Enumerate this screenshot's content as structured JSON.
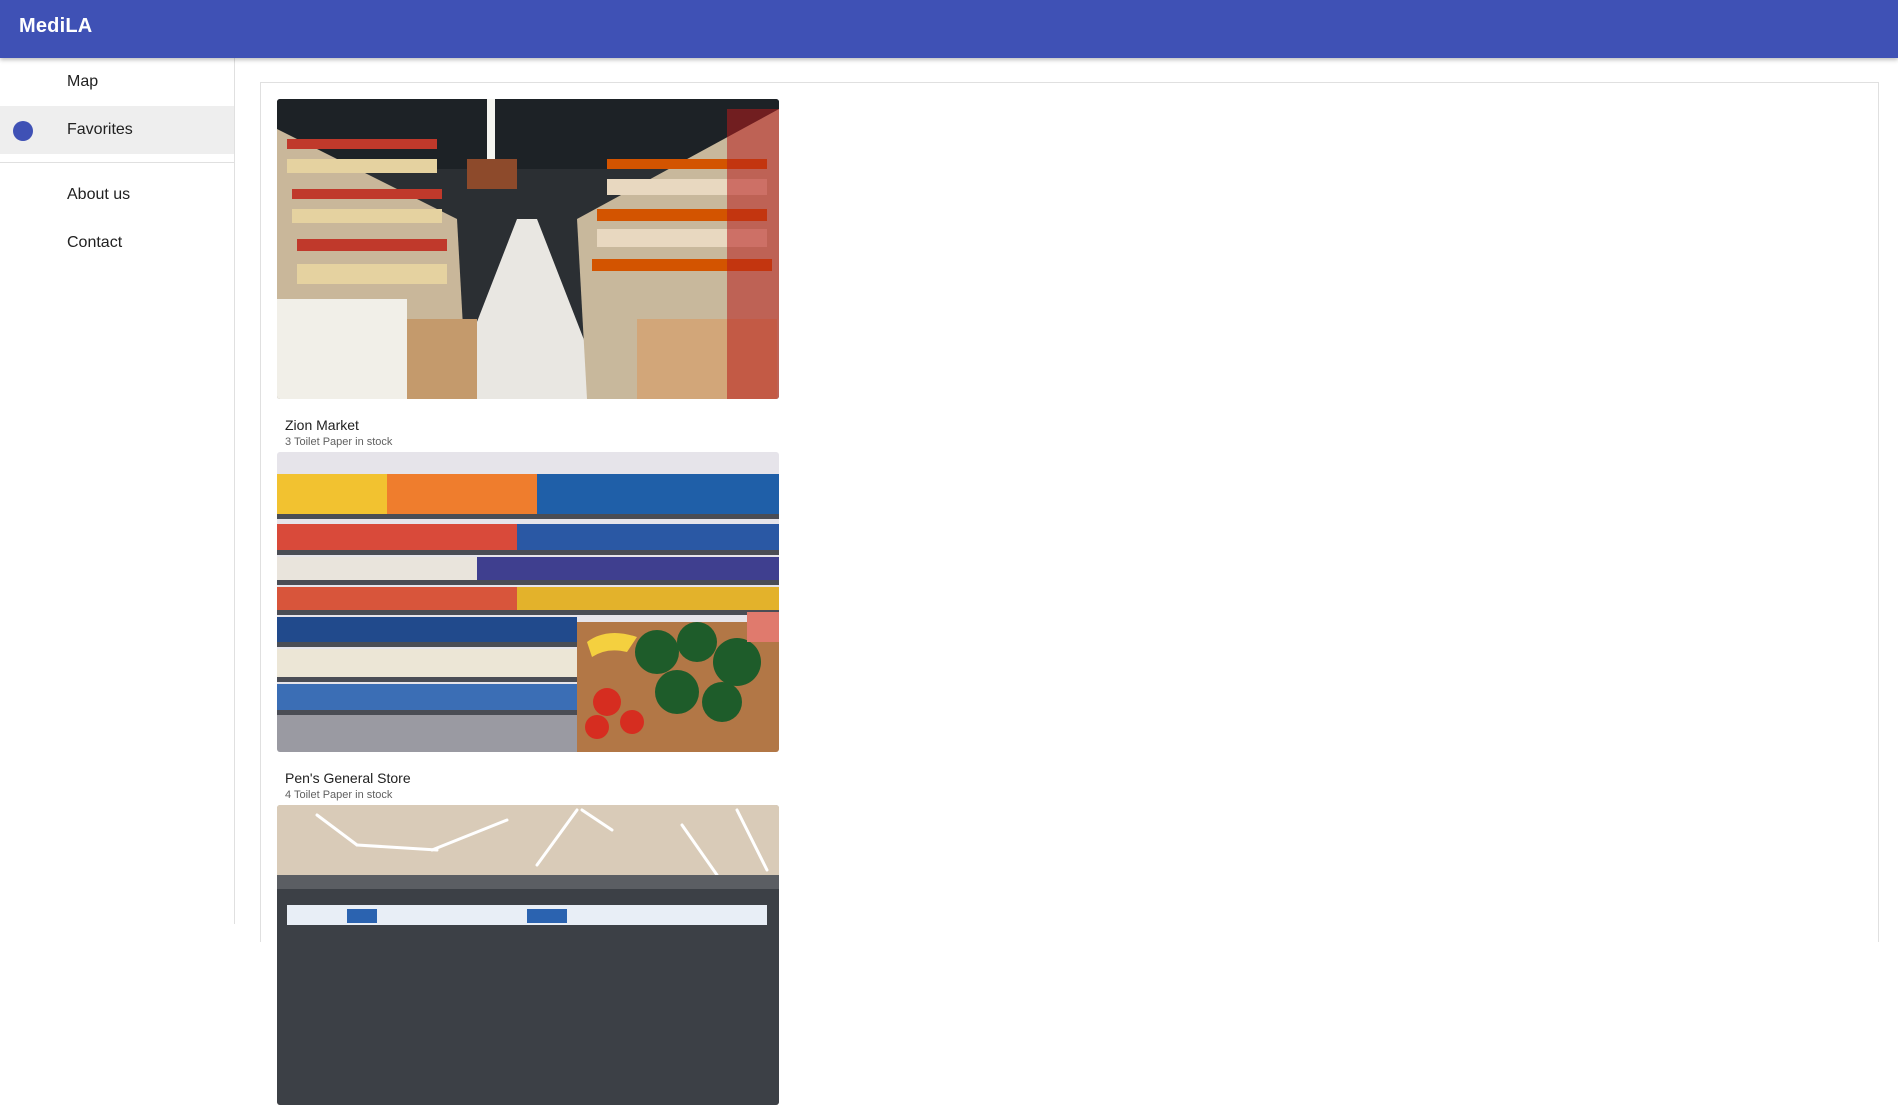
{
  "app": {
    "title": "MediLA"
  },
  "sidebar": {
    "primary": [
      {
        "label": "Map",
        "active": false
      },
      {
        "label": "Favorites",
        "active": true
      }
    ],
    "secondary": [
      {
        "label": "About us"
      },
      {
        "label": "Contact"
      }
    ],
    "active_indicator_color": "#3f51b5"
  },
  "stores": [
    {
      "name": "Zion Market",
      "stock": "3 Toilet Paper in stock",
      "photo_icon": "grocery-aisle-photo"
    },
    {
      "name": "Pen's General Store",
      "stock": "4 Toilet Paper in stock",
      "photo_icon": "grocery-shelves-produce-photo"
    },
    {
      "photo_icon": "dairy-fridge-photo"
    }
  ],
  "theme": {
    "primary": "#3f51b5",
    "divider": "#e0e0e0",
    "active_bg": "#eeeeee"
  }
}
